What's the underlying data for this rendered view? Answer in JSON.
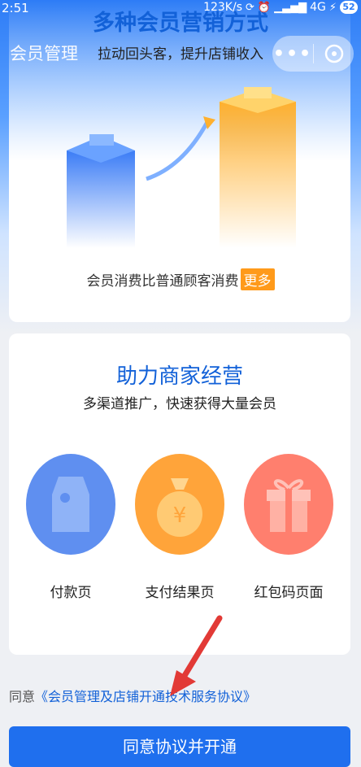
{
  "status_bar": {
    "time": "2:51",
    "speed": "123K/s",
    "network": "4G",
    "battery": "52"
  },
  "nav": {
    "title": "会员管理",
    "more_icon": "more-dots-icon",
    "close_icon": "close-circle-icon"
  },
  "card1": {
    "title": "多种会员营销方式",
    "subtitle": "拉动回头客，提升店铺收入",
    "bottom_text": "会员消费比普通顾客消费",
    "more_badge": "更多"
  },
  "card2": {
    "title": "助力商家经营",
    "subtitle": "多渠道推广，快速获得大量会员",
    "features": [
      {
        "label": "付款页",
        "icon": "price-tag-icon",
        "color": "#5f8ff0"
      },
      {
        "label": "支付结果页",
        "icon": "money-bag-icon",
        "color": "#ffa43a"
      },
      {
        "label": "红包码页面",
        "icon": "gift-icon",
        "color": "#ff7f6e"
      }
    ]
  },
  "agreement": {
    "prefix": "同意",
    "link": "《会员管理及店铺开通技术服务协议》"
  },
  "primary_button": {
    "label": "同意协议并开通"
  }
}
